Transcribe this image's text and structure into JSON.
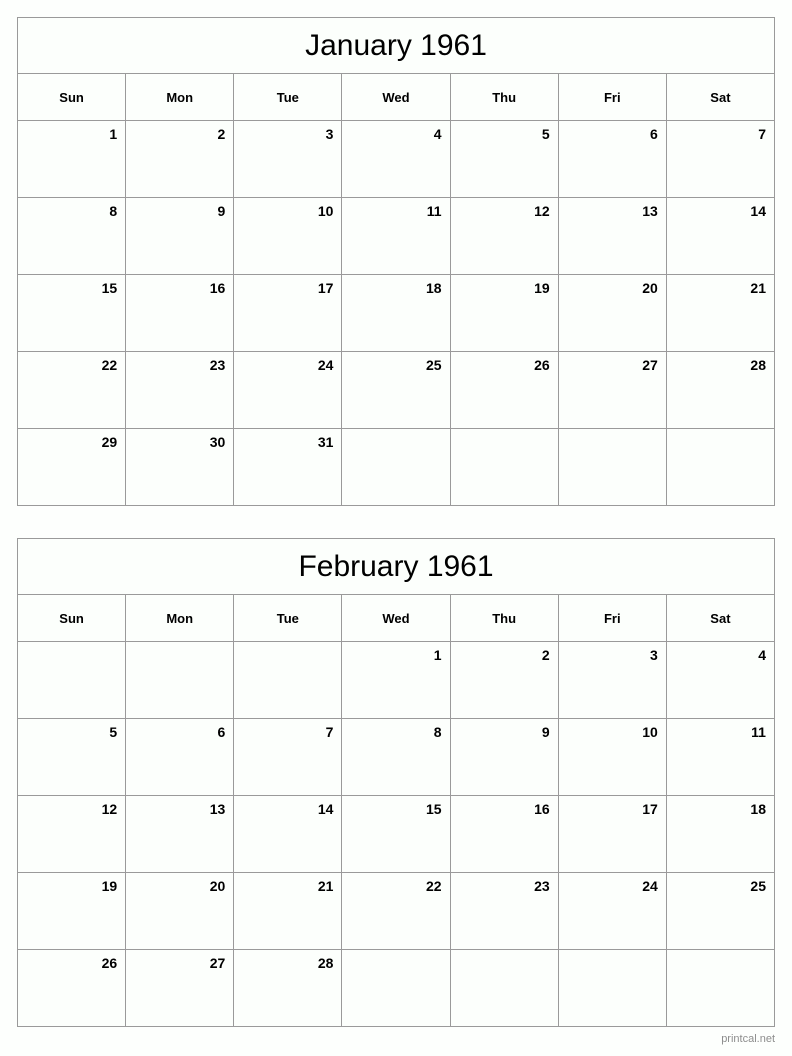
{
  "page": {
    "footer_text": "printcal.net",
    "border_color": "#9a9a9a",
    "background_color": "#fcfffc",
    "text_color": "#000000",
    "footer_color": "#8d8d8d"
  },
  "weekday_headers": [
    "Sun",
    "Mon",
    "Tue",
    "Wed",
    "Thu",
    "Fri",
    "Sat"
  ],
  "months": [
    {
      "title": "January 1961",
      "weeks": [
        [
          "1",
          "2",
          "3",
          "4",
          "5",
          "6",
          "7"
        ],
        [
          "8",
          "9",
          "10",
          "11",
          "12",
          "13",
          "14"
        ],
        [
          "15",
          "16",
          "17",
          "18",
          "19",
          "20",
          "21"
        ],
        [
          "22",
          "23",
          "24",
          "25",
          "26",
          "27",
          "28"
        ],
        [
          "29",
          "30",
          "31",
          "",
          "",
          "",
          ""
        ]
      ]
    },
    {
      "title": "February 1961",
      "weeks": [
        [
          "",
          "",
          "",
          "1",
          "2",
          "3",
          "4"
        ],
        [
          "5",
          "6",
          "7",
          "8",
          "9",
          "10",
          "11"
        ],
        [
          "12",
          "13",
          "14",
          "15",
          "16",
          "17",
          "18"
        ],
        [
          "19",
          "20",
          "21",
          "22",
          "23",
          "24",
          "25"
        ],
        [
          "26",
          "27",
          "28",
          "",
          "",
          "",
          ""
        ]
      ]
    }
  ]
}
